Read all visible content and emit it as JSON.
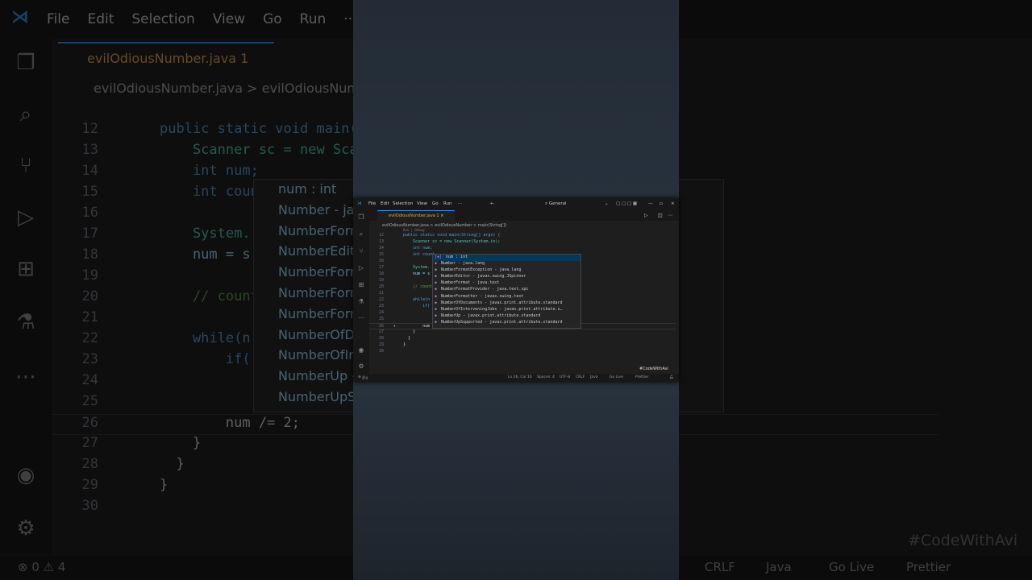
{
  "menu": [
    "File",
    "Edit",
    "Selection",
    "View",
    "Go",
    "Run",
    "···"
  ],
  "tab": "evilOdiousNumber.java 1",
  "breadcrumb": "evilOdiousNumber.java > evilOdiousNumber > main(String[])",
  "search": "General",
  "codelens": "Run | Debug",
  "code_lines": [
    {
      "no": "12",
      "text": "public static void main(String[] args) {"
    },
    {
      "no": "13",
      "text": "    Scanner sc = new Scanner(System.in);"
    },
    {
      "no": "14",
      "text": "    int num;"
    },
    {
      "no": "15",
      "text": "    int count"
    },
    {
      "no": "16",
      "text": ""
    },
    {
      "no": "17",
      "text": "    System."
    },
    {
      "no": "18",
      "text": "    num = s"
    },
    {
      "no": "19",
      "text": ""
    },
    {
      "no": "20",
      "text": "    // count"
    },
    {
      "no": "21",
      "text": ""
    },
    {
      "no": "22",
      "text": "    while(n"
    },
    {
      "no": "23",
      "text": "        if("
    },
    {
      "no": "24",
      "text": ""
    },
    {
      "no": "25",
      "text": ""
    },
    {
      "no": "26",
      "text": "        num /= 2;"
    },
    {
      "no": "27",
      "text": "    }"
    },
    {
      "no": "28",
      "text": "  }"
    },
    {
      "no": "29",
      "text": "}"
    },
    {
      "no": "30",
      "text": ""
    }
  ],
  "suggestions": [
    "num : int",
    "Number - java.lang",
    "NumberFormatException - java.lang",
    "NumberEditor - javax.swing.JSpinner",
    "NumberFormat - java.text",
    "NumberFormatProvider - java.text.spi",
    "NumberFormatter - javax.swing.text",
    "NumberOfDocuments - javax.print.attribute.standard",
    "NumberOfInterveningJobs - javax.print.attribute.s…",
    "NumberUp - javax.print.attribute.standard",
    "NumberUpSupported - javax.print.attribute.standard"
  ],
  "status": {
    "errors": "0",
    "warnings": "4",
    "position": "Ln 26, Col 16",
    "spaces": "Spaces: 4",
    "encoding": "UTF-8",
    "eol": "CRLF",
    "language": "Java",
    "golive": "Go Live",
    "prettier": "Prettier"
  },
  "watermark": "#CodeWithAvi",
  "icons": [
    "explorer-icon",
    "search-icon",
    "source-control-icon",
    "run-debug-icon",
    "extensions-icon",
    "testing-icon",
    "more-icon",
    "account-icon",
    "settings-icon"
  ]
}
